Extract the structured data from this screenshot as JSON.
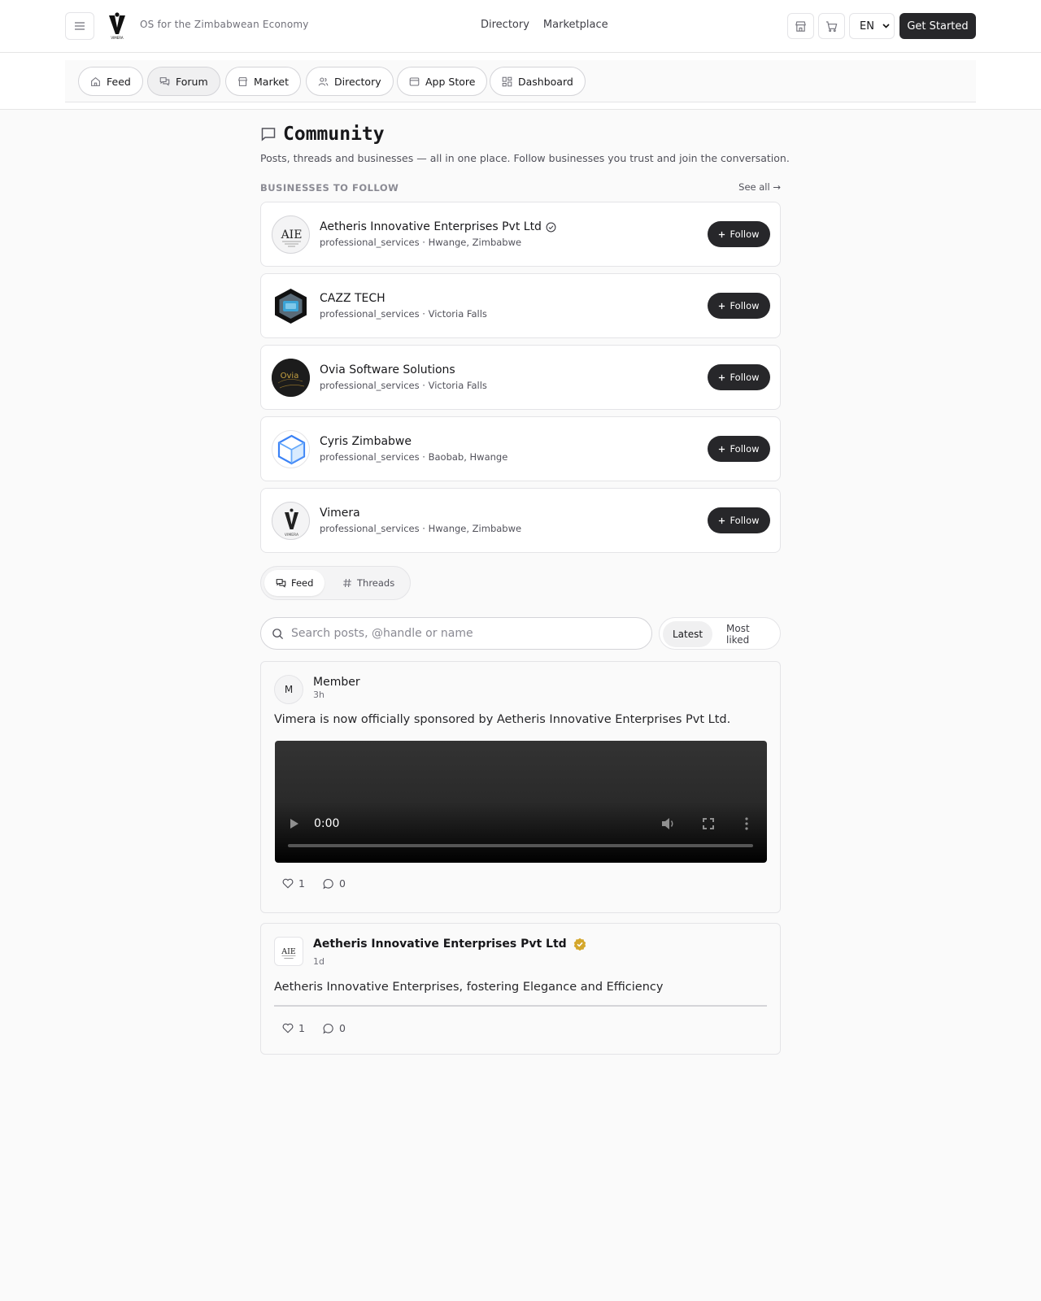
{
  "header": {
    "tagline": "OS for the Zimbabwean Economy",
    "nav": [
      "Directory",
      "Marketplace"
    ],
    "language": "EN",
    "cta": "Get Started",
    "logo_text": "VIMERA"
  },
  "subnav": {
    "items": [
      {
        "label": "Feed",
        "icon": "home-icon"
      },
      {
        "label": "Forum",
        "icon": "chat-icon",
        "active": true
      },
      {
        "label": "Market",
        "icon": "store-icon"
      },
      {
        "label": "Directory",
        "icon": "users-icon"
      },
      {
        "label": "App Store",
        "icon": "app-store-icon"
      },
      {
        "label": "Dashboard",
        "icon": "grid-icon"
      }
    ]
  },
  "community": {
    "title": "Community",
    "subtitle": "Posts, threads and businesses — all in one place. Follow businesses you trust and join the conversation.",
    "section_label": "BUSINESSES TO FOLLOW",
    "see_all": "See all →",
    "follow_label": "Follow",
    "businesses": [
      {
        "name": "Aetheris Innovative Enterprises Pvt Ltd",
        "category": "professional_services",
        "location": "Hwange, Zimbabwe",
        "verified": true,
        "logo_text": "AIE"
      },
      {
        "name": "CAZZ TECH",
        "category": "professional_services",
        "location": "Victoria Falls",
        "verified": false
      },
      {
        "name": "Ovia Software Solutions",
        "category": "professional_services",
        "location": "Victoria Falls",
        "verified": false,
        "logo_text": "Ovia"
      },
      {
        "name": "Cyris Zimbabwe",
        "category": "professional_services",
        "location": "Baobab, Hwange",
        "verified": false
      },
      {
        "name": "Vimera",
        "category": "professional_services",
        "location": "Hwange, Zimbabwe",
        "verified": false,
        "logo_text": "VIMERA"
      }
    ]
  },
  "feed_tabs": {
    "feed": "Feed",
    "threads": "Threads"
  },
  "search": {
    "placeholder": "Search posts, @handle or name"
  },
  "sort": {
    "latest": "Latest",
    "most_liked": "Most liked"
  },
  "posts": [
    {
      "author": "Member",
      "initial": "M",
      "time": "3h",
      "text": "Vimera is now officially sponsored by Aetheris Innovative Enterprises Pvt Ltd.",
      "video_time": "0:00",
      "likes": "1",
      "comments": "0"
    },
    {
      "author": "Aetheris Innovative Enterprises Pvt Ltd",
      "time": "1d",
      "text": "Aetheris Innovative Enterprises, fostering Elegance and Efficiency",
      "likes": "1",
      "comments": "0",
      "verified": true,
      "logo_text": "AIE"
    }
  ],
  "colors": {
    "primary": "#27272a",
    "background": "#fafafa",
    "verified_gold": "#d4a72c"
  }
}
